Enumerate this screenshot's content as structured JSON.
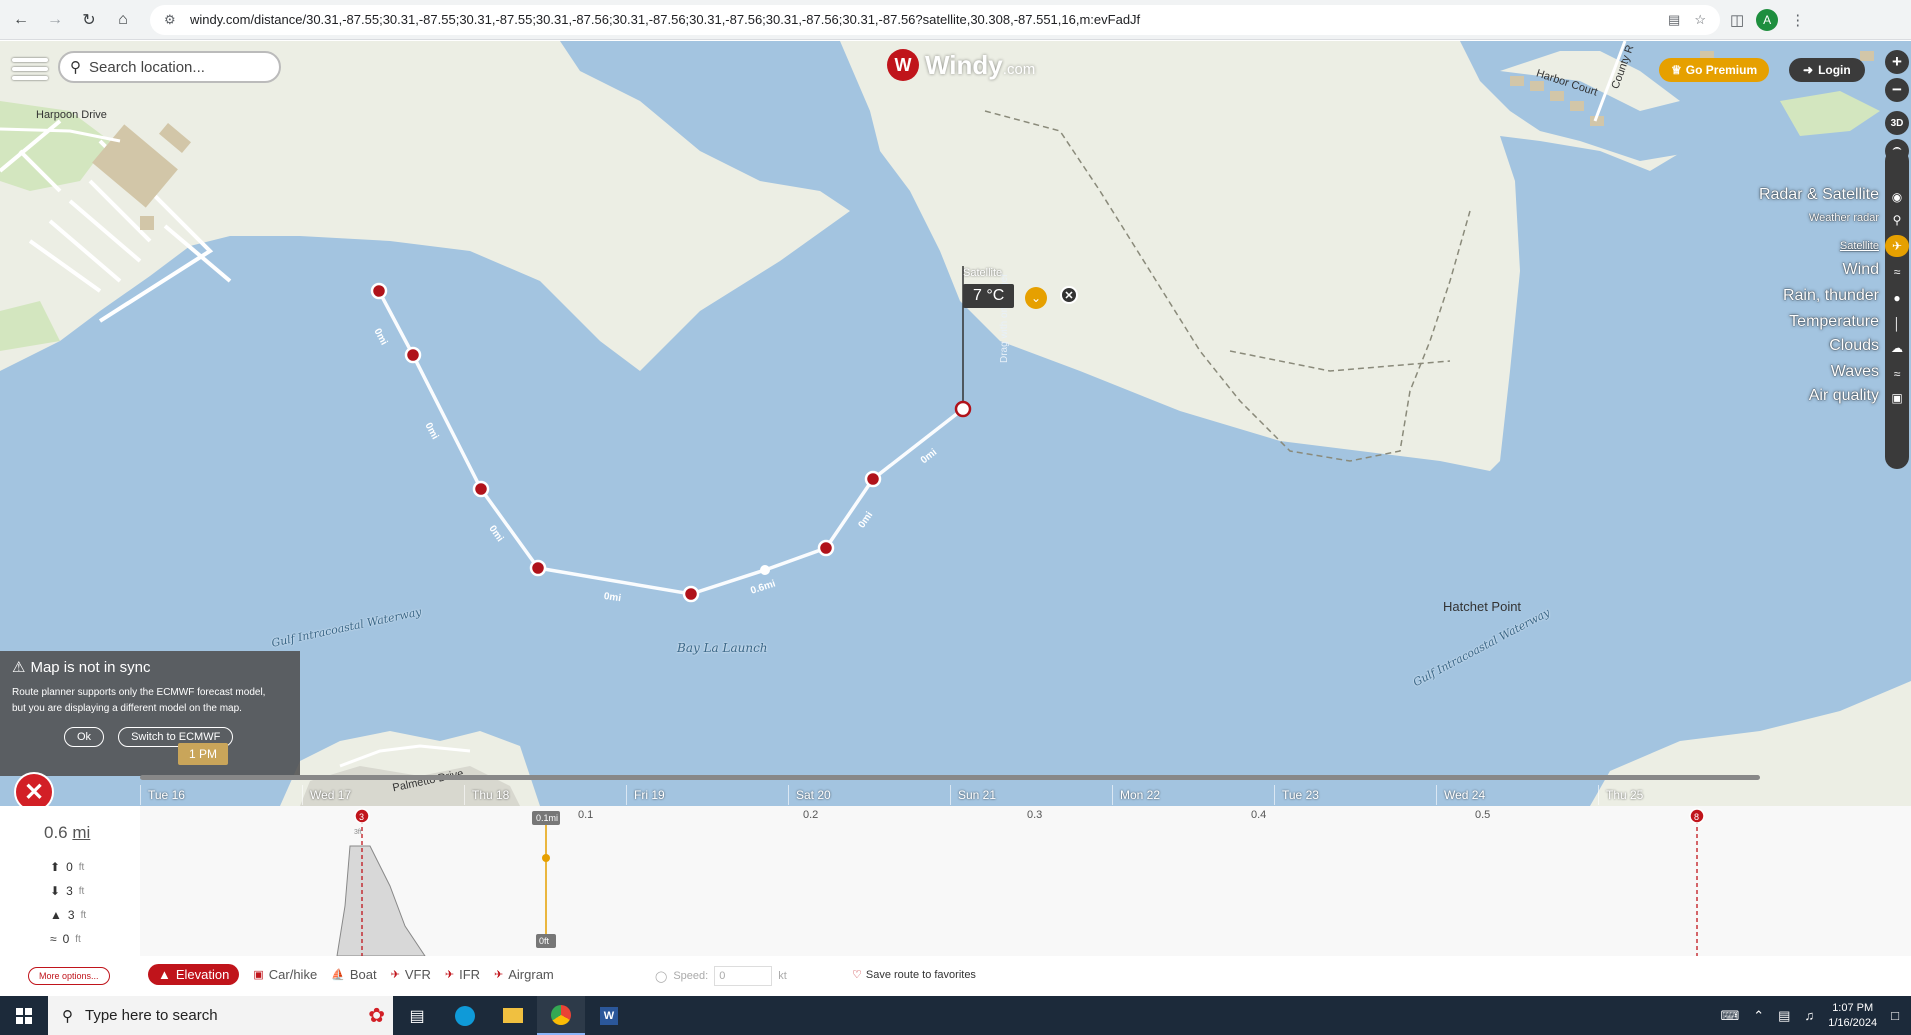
{
  "browser": {
    "url": "windy.com/distance/30.31,-87.55;30.31,-87.55;30.31,-87.55;30.31,-87.56;30.31,-87.56;30.31,-87.56;30.31,-87.56;30.31,-87.56?satellite,30.308,-87.551,16,m:evFadJf",
    "profile_initial": "A"
  },
  "map": {
    "search_placeholder": "Search location...",
    "logo_text": "Windy",
    "logo_suffix": "com",
    "premium_label": "Go Premium",
    "login_label": "Login",
    "zoom_in": "+",
    "zoom_out": "−",
    "btn_3d": "3D",
    "layers": {
      "radar_satellite": "Radar & Satellite",
      "weather_radar": "Weather radar",
      "satellite": "Satellite",
      "wind": "Wind",
      "rain": "Rain, thunder",
      "temperature": "Temperature",
      "clouds": "Clouds",
      "waves": "Waves",
      "air_quality": "Air quality"
    },
    "places": {
      "harpoon": "Harpoon Drive",
      "harbor_court": "Harbor Court",
      "county_rd": "County R",
      "palmetto": "Palmetto Drive",
      "hatchet_point": "Hatchet Point",
      "bay_la_launch": "Bay La Launch",
      "gulf_iww_left": "Gulf Intracoastal Waterway",
      "gulf_iww_right": "Gulf Intracoastal Waterway"
    },
    "marker": {
      "temperature": "7 °C",
      "tag": "Satellite",
      "drag_hint": "Drag with one finger"
    },
    "segment_labels": [
      "0mi",
      "0mi",
      "0mi",
      "0mi",
      "0.6mi",
      "0mi",
      "0mi"
    ]
  },
  "sync_notice": {
    "title": "Map is not in sync",
    "body": "Route planner supports only the ECMWF forecast model, but you are displaying a different model on the map.",
    "ok": "Ok",
    "switch": "Switch to ECMWF"
  },
  "timeline": {
    "time_bubble": "1 PM",
    "days": [
      "Tue 16",
      "Wed 17",
      "Thu 18",
      "Fri 19",
      "Sat 20",
      "Sun 21",
      "Mon 22",
      "Tue 23",
      "Wed 24",
      "Thu 25"
    ]
  },
  "route_panel": {
    "distance_value": "0.6",
    "distance_unit": "mi",
    "ascent": "0",
    "descent": "3",
    "max_elevation": "3",
    "min_elevation": "0",
    "unit_ft": "ft",
    "more_options": "More options...",
    "profile_ticks": [
      "0.1",
      "0.2",
      "0.3",
      "0.4",
      "0.5"
    ],
    "cursor_distance": "0.1mi",
    "cursor_elevation": "0ft",
    "start_marker": "3",
    "end_marker": "8",
    "start_sub": "3ft",
    "modes": [
      "Elevation",
      "Car/hike",
      "Boat",
      "VFR",
      "IFR",
      "Airgram"
    ],
    "speed_label": "Speed:",
    "speed_value": "0",
    "speed_unit": "kt",
    "save_label": "Save route to favorites"
  },
  "taskbar": {
    "search_text": "Type here to search",
    "time": "1:07 PM",
    "date": "1/16/2024"
  }
}
